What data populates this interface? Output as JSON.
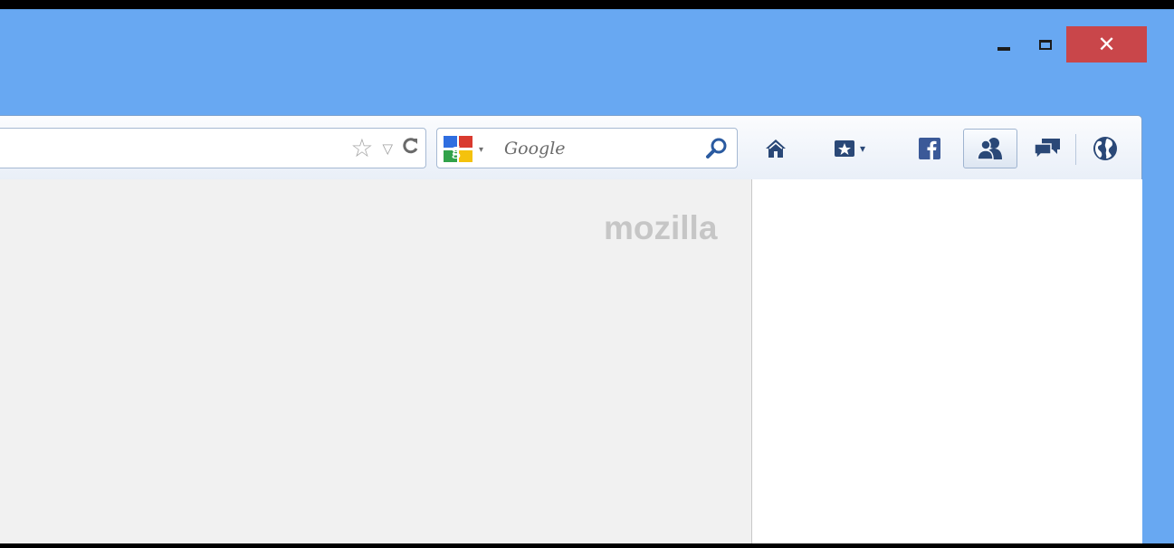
{
  "window_controls": {
    "minimize_icon": "minimize-icon",
    "maximize_icon": "maximize-icon",
    "close_glyph": "✕"
  },
  "urlbar": {
    "value": "",
    "bookmark_star": "☆",
    "dropmarker": "▽",
    "reload": "C"
  },
  "search": {
    "placeholder": "Google",
    "engine": "google-icon",
    "dropdown_arrow": "▾"
  },
  "toolbar": {
    "icons": [
      "home-icon",
      "bookmarks-menu-icon",
      "facebook-icon",
      "social-friends-icon",
      "chat-icon",
      "globe-icon"
    ],
    "bookmarks_arrow": "▾"
  },
  "content": {
    "logo_text": "mozilla"
  },
  "colors": {
    "titlebar": "#68a8f2",
    "close_button": "#c9464a",
    "toolbar_icon": "#2a4877",
    "facebook": "#3b5998"
  }
}
